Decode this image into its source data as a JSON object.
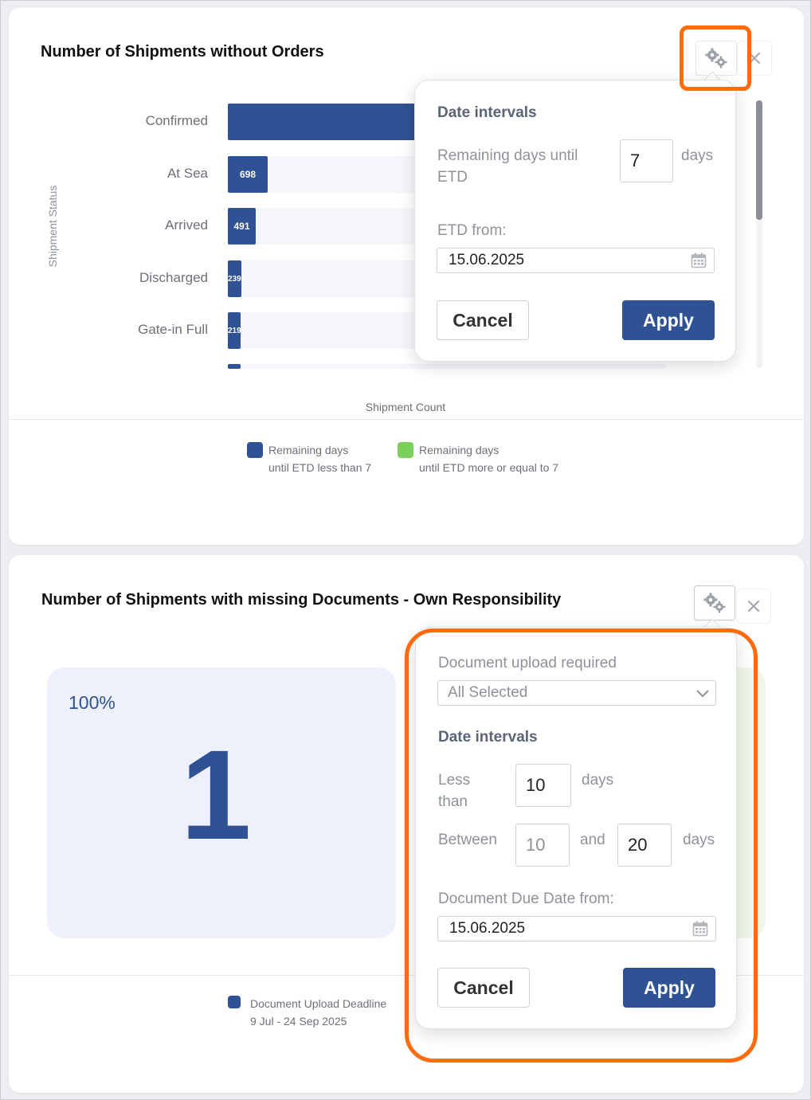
{
  "colors": {
    "accent": "#2e5293",
    "green": "#7ad05a",
    "highlight": "#ff6b0f",
    "tile_bg": "#eef0fc"
  },
  "icons": {
    "settings": "gears-icon",
    "close": "close-icon",
    "calendar": "calendar-icon",
    "dropdown": "chevron-down-icon"
  },
  "widget1": {
    "title": "Number of Shipments without Orders",
    "chart_data": {
      "type": "bar",
      "orientation": "horizontal",
      "title": "Number of Shipments without Orders",
      "xlabel": "Shipment Count",
      "ylabel": "Shipment Status",
      "categories": [
        "Confirmed",
        "At Sea",
        "Arrived",
        "Discharged",
        "Gate-in Full"
      ],
      "series": [
        {
          "name": "Remaining days until ETD less than 7",
          "values": [
            null,
            698,
            491,
            239,
            219
          ]
        }
      ],
      "value_labels": [
        "",
        "698",
        "491",
        "239",
        "219"
      ],
      "legend": [
        {
          "line1": "Remaining days",
          "line2": "until ETD less than 7"
        },
        {
          "line1": "Remaining days",
          "line2": "until ETD more or equal to 7"
        }
      ],
      "legend_position": "bottom"
    },
    "popover": {
      "heading": "Date intervals",
      "remaining_label": "Remaining days until ETD",
      "remaining_value": "7",
      "days_unit": "days",
      "etd_from_label": "ETD from:",
      "etd_from_value": "15.06.2025",
      "cancel": "Cancel",
      "apply": "Apply"
    }
  },
  "widget2": {
    "title": "Number of Shipments with missing Documents - Own Responsibility",
    "tile": {
      "percent": "100%",
      "value": "1"
    },
    "legend": {
      "line1": "Document Upload Deadline",
      "line2": "9 Jul - 24 Sep 2025"
    },
    "popover": {
      "upload_required_label": "Document upload required",
      "upload_required_value": "All Selected",
      "heading": "Date intervals",
      "less_than_label": "Less than",
      "less_than_value": "10",
      "between_label": "Between",
      "between_from": "10",
      "and_label": "and",
      "between_to": "20",
      "days_unit": "days",
      "due_date_label": "Document Due Date from:",
      "due_date_value": "15.06.2025",
      "cancel": "Cancel",
      "apply": "Apply"
    }
  }
}
